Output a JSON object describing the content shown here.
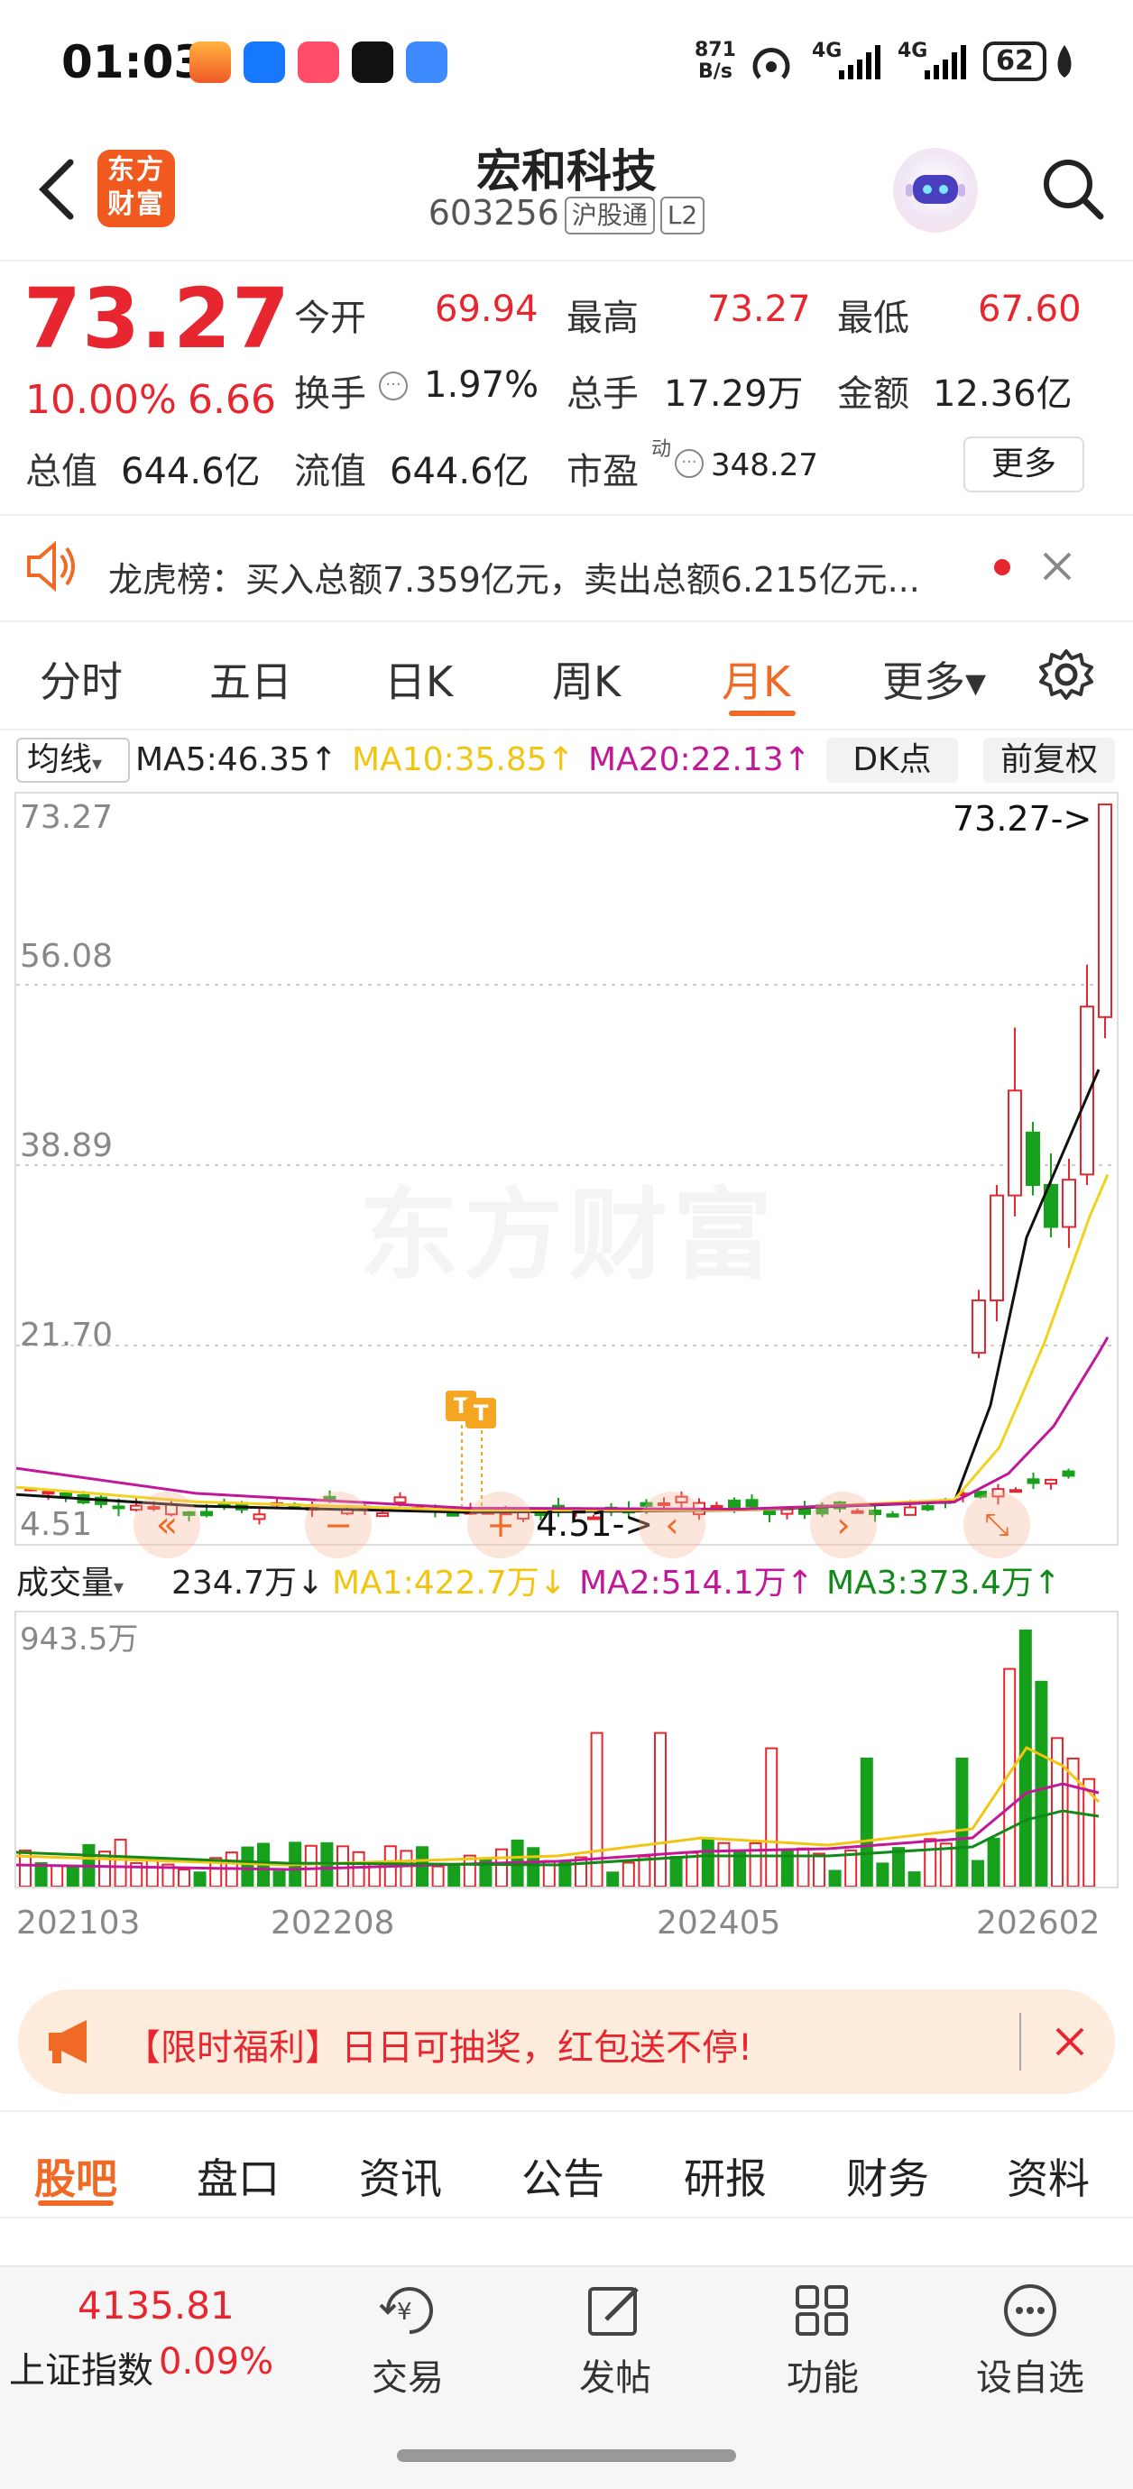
{
  "status_bar": {
    "time": "01:03",
    "net_speed_value": "871",
    "net_speed_unit": "B/s",
    "signal_1": "4G",
    "signal_2": "4G",
    "battery": "62"
  },
  "header": {
    "title": "宏和科技",
    "code": "603256",
    "tag_connect": "沪股通",
    "tag_level": "L2",
    "logo_text": "东方财富"
  },
  "quote": {
    "price": "73.27",
    "change_pct": "10.00%",
    "change": "6.66",
    "open_label": "今开",
    "open": "69.94",
    "high_label": "最高",
    "high": "73.27",
    "low_label": "最低",
    "low": "67.60",
    "turnover_label": "换手",
    "turnover": "1.97%",
    "volume_label": "总手",
    "volume": "17.29万",
    "amount_label": "金额",
    "amount": "12.36亿",
    "mcap_label": "总值",
    "mcap": "644.6亿",
    "float_label": "流值",
    "float": "644.6亿",
    "pe_label": "市盈",
    "pe_sup": "动",
    "pe": "348.27",
    "more_button": "更多"
  },
  "notice": {
    "text": "龙虎榜：买入总额7.359亿元，卖出总额6.215亿元..."
  },
  "period_tabs": [
    "分时",
    "五日",
    "日K",
    "周K",
    "月K",
    "更多▾"
  ],
  "active_period": 4,
  "ma_bar": {
    "selector": "均线",
    "ma5": "MA5:46.35↑",
    "ma10": "MA10:35.85↑",
    "ma20": "MA20:22.13↑",
    "dk_button": "DK点",
    "adjust_button": "前复权"
  },
  "kline": {
    "y_labels": [
      "73.27",
      "56.08",
      "38.89",
      "21.70",
      "4.51"
    ],
    "max_marker": "73.27->",
    "min_marker": "4.51->",
    "watermark": "东方财富",
    "t_marker": "T"
  },
  "volume_bar": {
    "selector": "成交量",
    "vol": "234.7万↓",
    "ma1": "MA1:422.7万↓",
    "ma2": "MA2:514.1万↑",
    "ma3": "MA3:373.4万↑",
    "max_label": "943.5万"
  },
  "x_labels": [
    "202103",
    "202208",
    "202405",
    "202602"
  ],
  "promo": {
    "text": "【限时福利】日日可抽奖，红包送不停!"
  },
  "bottom_tabs": [
    "股吧",
    "盘口",
    "资讯",
    "公告",
    "研报",
    "财务",
    "资料"
  ],
  "bottom_nav": {
    "index_value": "4135.81",
    "index_name": "上证指数",
    "index_change": "0.09%",
    "trade": "交易",
    "post": "发帖",
    "function": "功能",
    "add_watch": "设自选"
  },
  "chart_data": {
    "type": "candlestick",
    "ylim": [
      4.51,
      73.27
    ],
    "x_ticks": [
      "202103",
      "202208",
      "202405",
      "202602"
    ],
    "recent_candles": [
      {
        "open": 21.0,
        "high": 27.0,
        "low": 20.5,
        "close": 26.0
      },
      {
        "open": 26.0,
        "high": 37.0,
        "low": 24.0,
        "close": 36.0
      },
      {
        "open": 36.0,
        "high": 52.0,
        "low": 34.0,
        "close": 46.0
      },
      {
        "open": 42.0,
        "high": 43.0,
        "low": 36.0,
        "close": 37.0
      },
      {
        "open": 37.0,
        "high": 40.0,
        "low": 32.0,
        "close": 33.0
      },
      {
        "open": 33.0,
        "high": 39.5,
        "low": 31.0,
        "close": 37.5
      },
      {
        "open": 38.0,
        "high": 58.0,
        "low": 37.0,
        "close": 54.0
      },
      {
        "open": 53.0,
        "high": 73.27,
        "low": 51.0,
        "close": 73.27
      }
    ]
  }
}
